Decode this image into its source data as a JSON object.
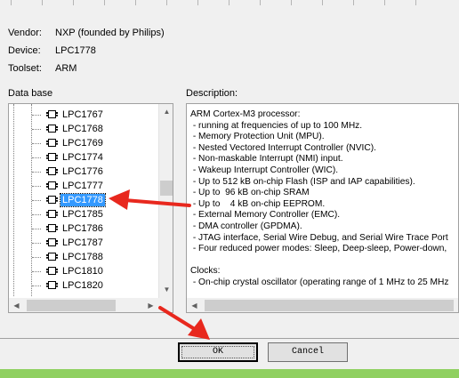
{
  "info": {
    "vendor_label": "Vendor:",
    "vendor_value": "NXP (founded by Philips)",
    "device_label": "Device:",
    "device_value": "LPC1778",
    "toolset_label": "Toolset:",
    "toolset_value": "ARM"
  },
  "database": {
    "label": "Data base",
    "items": [
      "LPC1767",
      "LPC1768",
      "LPC1769",
      "LPC1774",
      "LPC1776",
      "LPC1777",
      "LPC1778",
      "LPC1785",
      "LPC1786",
      "LPC1787",
      "LPC1788",
      "LPC1810",
      "LPC1820"
    ],
    "selected": "LPC1778",
    "icon": "chip-icon"
  },
  "description": {
    "label": "Description:",
    "lines": [
      "ARM Cortex-M3 processor:",
      " - running at frequencies of up to 100 MHz.",
      " - Memory Protection Unit (MPU).",
      " - Nested Vectored Interrupt Controller (NVIC).",
      " - Non-maskable Interrupt (NMI) input.",
      " - Wakeup Interrupt Controller (WIC).",
      " - Up to 512 kB on-chip Flash (ISP and IAP capabilities).",
      " - Up to  96 kB on-chip SRAM",
      " - Up to    4 kB on-chip EEPROM.",
      " - External Memory Controller (EMC).",
      " - DMA controller (GPDMA).",
      " - JTAG interface, Serial Wire Debug, and Serial Wire Trace Port",
      " - Four reduced power modes: Sleep, Deep-sleep, Power-down,",
      "",
      "Clocks:",
      " - On-chip crystal oscillator (operating range of 1 MHz to 25 MHz"
    ]
  },
  "buttons": {
    "ok": "OK",
    "cancel": "Cancel"
  },
  "colors": {
    "selection": "#3399ff",
    "arrow": "#e8281e",
    "taskbar": "#8fd060"
  }
}
